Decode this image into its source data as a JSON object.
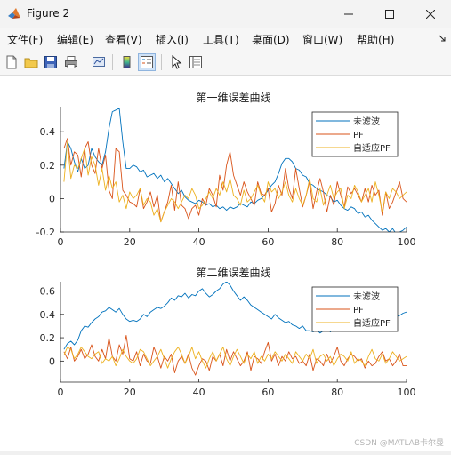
{
  "window": {
    "title": "Figure 2",
    "controls": {
      "minimize": "minimize",
      "maximize": "maximize",
      "close": "close"
    }
  },
  "menubar": {
    "items": [
      {
        "label": "文件(F)"
      },
      {
        "label": "编辑(E)"
      },
      {
        "label": "查看(V)"
      },
      {
        "label": "插入(I)"
      },
      {
        "label": "工具(T)"
      },
      {
        "label": "桌面(D)"
      },
      {
        "label": "窗口(W)"
      },
      {
        "label": "帮助(H)"
      }
    ],
    "overflow_icon": "arrow-overflow-icon"
  },
  "toolbar": {
    "icons": [
      "new-figure-icon",
      "open-file-icon",
      "save-icon",
      "print-icon",
      "link-plot-icon",
      "colorbar-icon",
      "legend-icon",
      "pointer-icon",
      "property-inspector-icon"
    ]
  },
  "watermark": "CSDN @MATLAB卡尔曼",
  "colors": {
    "series1": "#0072BD",
    "series2": "#D95319",
    "series3": "#EDB120"
  },
  "chart_data": [
    {
      "type": "line",
      "title": "第一维误差曲线",
      "xlim": [
        0,
        100
      ],
      "ylim": [
        -0.2,
        0.55
      ],
      "xticks": [
        0,
        20,
        40,
        60,
        80,
        100
      ],
      "yticks": [
        -0.2,
        0,
        0.2,
        0.4
      ],
      "legend_position": "top-right",
      "grid": false,
      "x": [
        1,
        2,
        3,
        4,
        5,
        6,
        7,
        8,
        9,
        10,
        11,
        12,
        13,
        14,
        15,
        16,
        17,
        18,
        19,
        20,
        21,
        22,
        23,
        24,
        25,
        26,
        27,
        28,
        29,
        30,
        31,
        32,
        33,
        34,
        35,
        36,
        37,
        38,
        39,
        40,
        41,
        42,
        43,
        44,
        45,
        46,
        47,
        48,
        49,
        50,
        51,
        52,
        53,
        54,
        55,
        56,
        57,
        58,
        59,
        60,
        61,
        62,
        63,
        64,
        65,
        66,
        67,
        68,
        69,
        70,
        71,
        72,
        73,
        74,
        75,
        76,
        77,
        78,
        79,
        80,
        81,
        82,
        83,
        84,
        85,
        86,
        87,
        88,
        89,
        90,
        91,
        92,
        93,
        94,
        95,
        96,
        97,
        98,
        99,
        100
      ],
      "series": [
        {
          "name": "未滤波",
          "color": "#0072BD",
          "values": [
            0.18,
            0.34,
            0.3,
            0.22,
            0.16,
            0.24,
            0.18,
            0.2,
            0.3,
            0.25,
            0.22,
            0.2,
            0.28,
            0.42,
            0.52,
            0.53,
            0.54,
            0.34,
            0.18,
            0.18,
            0.2,
            0.19,
            0.16,
            0.17,
            0.13,
            0.14,
            0.15,
            0.12,
            0.14,
            0.1,
            0.12,
            0.09,
            0.06,
            0.03,
            0.05,
            0.01,
            -0.01,
            -0.02,
            -0.03,
            -0.01,
            -0.02,
            -0.04,
            -0.03,
            -0.05,
            -0.04,
            -0.06,
            -0.05,
            -0.07,
            -0.05,
            -0.06,
            -0.05,
            -0.03,
            -0.04,
            -0.05,
            -0.02,
            -0.03,
            -0.01,
            0.0,
            0.02,
            0.05,
            0.08,
            0.1,
            0.15,
            0.21,
            0.24,
            0.24,
            0.22,
            0.18,
            0.17,
            0.14,
            0.13,
            0.09,
            0.08,
            0.06,
            0.05,
            0.04,
            0.02,
            0.01,
            -0.02,
            -0.01,
            -0.04,
            -0.06,
            -0.07,
            -0.05,
            -0.06,
            -0.09,
            -0.08,
            -0.11,
            -0.1,
            -0.13,
            -0.15,
            -0.17,
            -0.19,
            -0.18,
            -0.2,
            -0.18,
            -0.21,
            -0.2,
            -0.19,
            -0.17
          ]
        },
        {
          "name": "PF",
          "color": "#D95319",
          "values": [
            0.3,
            0.36,
            0.2,
            0.28,
            0.26,
            0.13,
            0.3,
            0.34,
            0.2,
            0.15,
            0.3,
            0.18,
            0.26,
            0.05,
            0.0,
            0.3,
            0.28,
            0.05,
            0.02,
            -0.02,
            -0.03,
            -0.05,
            0.06,
            -0.06,
            -0.02,
            0.04,
            -0.05,
            0.02,
            -0.14,
            -0.08,
            -0.02,
            0.08,
            -0.07,
            0.1,
            -0.04,
            -0.06,
            -0.12,
            -0.06,
            -0.04,
            -0.1,
            0.0,
            -0.04,
            0.06,
            0.02,
            -0.05,
            0.14,
            0.05,
            0.2,
            0.28,
            0.14,
            0.08,
            0.02,
            0.1,
            0.04,
            0.0,
            -0.04,
            0.1,
            0.03,
            0.02,
            0.06,
            -0.08,
            -0.03,
            0.08,
            0.02,
            0.18,
            0.06,
            0.0,
            0.18,
            0.06,
            -0.05,
            0.02,
            0.1,
            -0.06,
            0.04,
            0.12,
            0.04,
            -0.08,
            0.02,
            -0.04,
            0.1,
            0.02,
            -0.05,
            0.07,
            0.03,
            0.06,
            0.02,
            -0.02,
            0.06,
            -0.02,
            0.08,
            0.02,
            0.05,
            -0.1,
            0.04,
            -0.06,
            -0.02,
            0.04,
            0.1,
            0.0,
            -0.02
          ]
        },
        {
          "name": "自适应PF",
          "color": "#EDB120",
          "values": [
            0.1,
            0.34,
            0.12,
            0.2,
            0.18,
            0.24,
            0.3,
            0.14,
            0.25,
            0.2,
            0.08,
            0.18,
            0.05,
            0.14,
            0.06,
            0.1,
            -0.02,
            0.02,
            -0.06,
            0.04,
            0.0,
            0.02,
            0.06,
            -0.04,
            0.0,
            -0.02,
            -0.1,
            -0.06,
            -0.14,
            -0.08,
            -0.04,
            0.0,
            -0.02,
            -0.06,
            -0.02,
            0.02,
            0.0,
            0.06,
            0.02,
            -0.06,
            -0.04,
            0.0,
            0.04,
            0.0,
            0.06,
            0.02,
            0.1,
            0.04,
            0.12,
            0.02,
            0.0,
            -0.04,
            0.05,
            -0.02,
            0.0,
            0.04,
            0.08,
            0.02,
            -0.02,
            0.1,
            0.04,
            0.06,
            0.0,
            0.04,
            0.1,
            0.02,
            -0.02,
            0.06,
            0.0,
            -0.04,
            0.02,
            0.12,
            0.0,
            -0.02,
            0.06,
            -0.04,
            0.02,
            0.08,
            0.0,
            0.04,
            0.06,
            -0.06,
            0.02,
            0.0,
            0.08,
            0.04,
            -0.02,
            0.02,
            0.06,
            -0.02,
            0.1,
            0.02,
            -0.08,
            0.04,
            0.0,
            0.06,
            0.04,
            0.0,
            0.02,
            0.04
          ]
        }
      ]
    },
    {
      "type": "line",
      "title": "第二维误差曲线",
      "xlim": [
        0,
        100
      ],
      "ylim": [
        -0.18,
        0.68
      ],
      "xticks": [
        0,
        20,
        40,
        60,
        80,
        100
      ],
      "yticks": [
        0,
        0.2,
        0.4,
        0.6
      ],
      "legend_position": "top-right",
      "grid": false,
      "x": [
        1,
        2,
        3,
        4,
        5,
        6,
        7,
        8,
        9,
        10,
        11,
        12,
        13,
        14,
        15,
        16,
        17,
        18,
        19,
        20,
        21,
        22,
        23,
        24,
        25,
        26,
        27,
        28,
        29,
        30,
        31,
        32,
        33,
        34,
        35,
        36,
        37,
        38,
        39,
        40,
        41,
        42,
        43,
        44,
        45,
        46,
        47,
        48,
        49,
        50,
        51,
        52,
        53,
        54,
        55,
        56,
        57,
        58,
        59,
        60,
        61,
        62,
        63,
        64,
        65,
        66,
        67,
        68,
        69,
        70,
        71,
        72,
        73,
        74,
        75,
        76,
        77,
        78,
        79,
        80,
        81,
        82,
        83,
        84,
        85,
        86,
        87,
        88,
        89,
        90,
        91,
        92,
        93,
        94,
        95,
        96,
        97,
        98,
        99,
        100
      ],
      "series": [
        {
          "name": "未滤波",
          "color": "#0072BD",
          "values": [
            0.1,
            0.15,
            0.17,
            0.14,
            0.18,
            0.26,
            0.3,
            0.29,
            0.33,
            0.36,
            0.38,
            0.42,
            0.43,
            0.46,
            0.44,
            0.42,
            0.45,
            0.4,
            0.36,
            0.34,
            0.35,
            0.34,
            0.36,
            0.4,
            0.38,
            0.42,
            0.44,
            0.46,
            0.45,
            0.47,
            0.5,
            0.54,
            0.52,
            0.56,
            0.55,
            0.58,
            0.54,
            0.57,
            0.56,
            0.6,
            0.62,
            0.58,
            0.55,
            0.57,
            0.6,
            0.62,
            0.66,
            0.68,
            0.65,
            0.6,
            0.56,
            0.52,
            0.55,
            0.52,
            0.48,
            0.46,
            0.44,
            0.42,
            0.4,
            0.38,
            0.36,
            0.4,
            0.37,
            0.35,
            0.33,
            0.34,
            0.31,
            0.3,
            0.28,
            0.3,
            0.26,
            0.26,
            0.25,
            0.27,
            0.24,
            0.26,
            0.28,
            0.25,
            0.28,
            0.27,
            0.3,
            0.28,
            0.32,
            0.3,
            0.34,
            0.3,
            0.32,
            0.34,
            0.36,
            0.34,
            0.36,
            0.38,
            0.34,
            0.37,
            0.38,
            0.35,
            0.38,
            0.39,
            0.41,
            0.42
          ]
        },
        {
          "name": "PF",
          "color": "#D95319",
          "values": [
            0.08,
            0.02,
            0.12,
            0.0,
            0.04,
            0.1,
            0.02,
            0.06,
            0.14,
            0.04,
            0.0,
            0.1,
            0.02,
            0.2,
            0.04,
            0.0,
            0.14,
            0.06,
            0.22,
            0.02,
            0.0,
            0.08,
            -0.04,
            0.06,
            0.0,
            -0.02,
            0.12,
            0.04,
            -0.06,
            0.04,
            0.0,
            0.06,
            -0.1,
            0.0,
            0.04,
            -0.02,
            0.06,
            -0.06,
            -0.12,
            -0.04,
            0.02,
            0.0,
            -0.08,
            0.04,
            0.0,
            0.06,
            -0.04,
            0.1,
            0.0,
            0.08,
            0.02,
            -0.04,
            0.0,
            0.08,
            -0.08,
            0.04,
            0.02,
            -0.02,
            0.08,
            0.16,
            0.0,
            0.06,
            -0.04,
            0.04,
            0.0,
            0.08,
            0.02,
            0.04,
            -0.02,
            0.0,
            -0.04,
            0.06,
            -0.08,
            0.02,
            0.0,
            -0.04,
            0.06,
            -0.02,
            0.04,
            0.12,
            0.0,
            -0.04,
            0.02,
            0.06,
            0.04,
            0.0,
            0.02,
            -0.06,
            0.0,
            -0.04,
            -0.02,
            0.04,
            0.08,
            0.0,
            0.02,
            -0.04,
            0.0,
            0.06,
            -0.04,
            -0.04
          ]
        },
        {
          "name": "自适应PF",
          "color": "#EDB120",
          "values": [
            0.05,
            0.12,
            0.1,
            0.02,
            0.06,
            0.12,
            0.08,
            0.04,
            0.02,
            0.06,
            0.08,
            -0.02,
            0.02,
            0.0,
            0.04,
            -0.04,
            0.02,
            0.1,
            0.04,
            0.0,
            -0.02,
            0.02,
            0.1,
            0.08,
            0.02,
            -0.04,
            0.0,
            0.04,
            0.1,
            0.02,
            -0.06,
            0.02,
            0.08,
            0.12,
            0.06,
            -0.02,
            0.04,
            0.12,
            0.02,
            0.08,
            0.0,
            -0.06,
            0.02,
            0.08,
            0.0,
            0.06,
            0.12,
            0.02,
            -0.04,
            0.04,
            0.1,
            0.04,
            -0.02,
            0.06,
            0.02,
            0.08,
            -0.02,
            0.04,
            0.0,
            0.06,
            0.02,
            0.08,
            0.04,
            0.0,
            0.06,
            0.02,
            -0.02,
            0.08,
            0.04,
            0.0,
            0.06,
            0.02,
            0.1,
            -0.02,
            0.04,
            0.06,
            0.0,
            0.04,
            -0.04,
            0.02,
            0.06,
            0.04,
            0.0,
            0.08,
            -0.02,
            0.02,
            0.0,
            -0.04,
            0.04,
            0.1,
            0.02,
            0.0,
            0.06,
            -0.02,
            0.02,
            0.08,
            0.04,
            0.0,
            0.02,
            0.04
          ]
        }
      ]
    }
  ]
}
